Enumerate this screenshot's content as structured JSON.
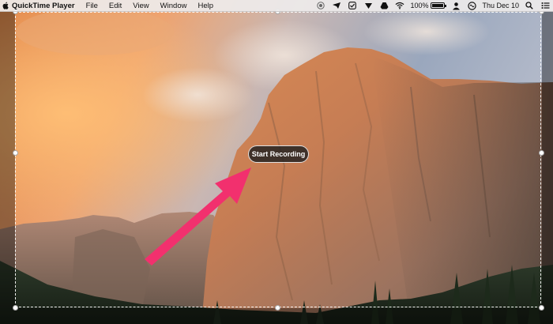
{
  "menubar": {
    "app_name": "QuickTime Player",
    "items": [
      "File",
      "Edit",
      "View",
      "Window",
      "Help"
    ],
    "battery": "100%",
    "datetime": "Thu Dec 10",
    "status_icons": [
      "record-indicator-icon",
      "location-arrow-icon",
      "checkbox-icon",
      "vpn-icon",
      "drive-icon",
      "wifi-icon",
      "battery-icon",
      "user-icon",
      "search-icon",
      "siri-icon",
      "notification-center-icon"
    ]
  },
  "record_button": {
    "label": "Start Recording"
  },
  "annotation": {
    "arrow_color": "#f2306e"
  }
}
